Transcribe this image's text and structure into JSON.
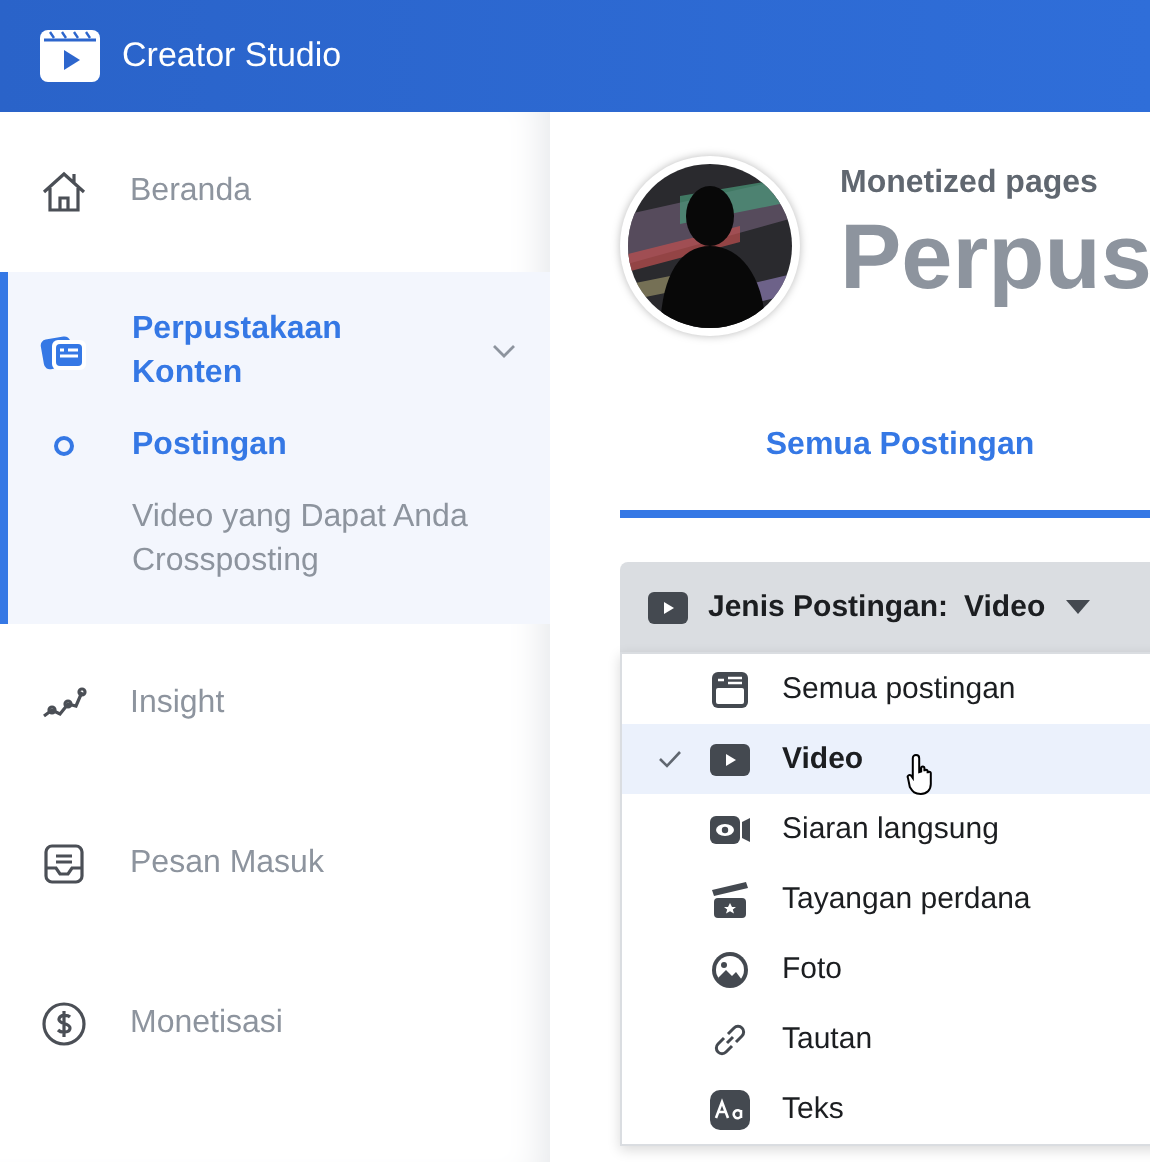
{
  "app": {
    "title": "Creator Studio"
  },
  "sidebar": {
    "items": [
      {
        "label": "Beranda",
        "selected": false
      },
      {
        "label": "Perpustakaan Konten",
        "selected": true,
        "expanded": true,
        "children": [
          {
            "label": "Postingan",
            "selected": true
          },
          {
            "label": "Video yang Dapat Anda Crossposting",
            "selected": false
          }
        ]
      },
      {
        "label": "Insight",
        "selected": false
      },
      {
        "label": "Pesan Masuk",
        "selected": false
      },
      {
        "label": "Monetisasi",
        "selected": false
      }
    ]
  },
  "page": {
    "subtitle": "Monetized pages",
    "title": "Perpus"
  },
  "tabs": [
    {
      "label": "Semua Postingan",
      "selected": true
    }
  ],
  "filter": {
    "label": "Jenis Postingan:",
    "value": "Video",
    "open": true
  },
  "menu": [
    {
      "label": "Semua postingan",
      "selected": false
    },
    {
      "label": "Video",
      "selected": true
    },
    {
      "label": "Siaran langsung",
      "selected": false
    },
    {
      "label": "Tayangan perdana",
      "selected": false
    },
    {
      "label": "Foto",
      "selected": false
    },
    {
      "label": "Tautan",
      "selected": false
    },
    {
      "label": "Teks",
      "selected": false
    }
  ]
}
